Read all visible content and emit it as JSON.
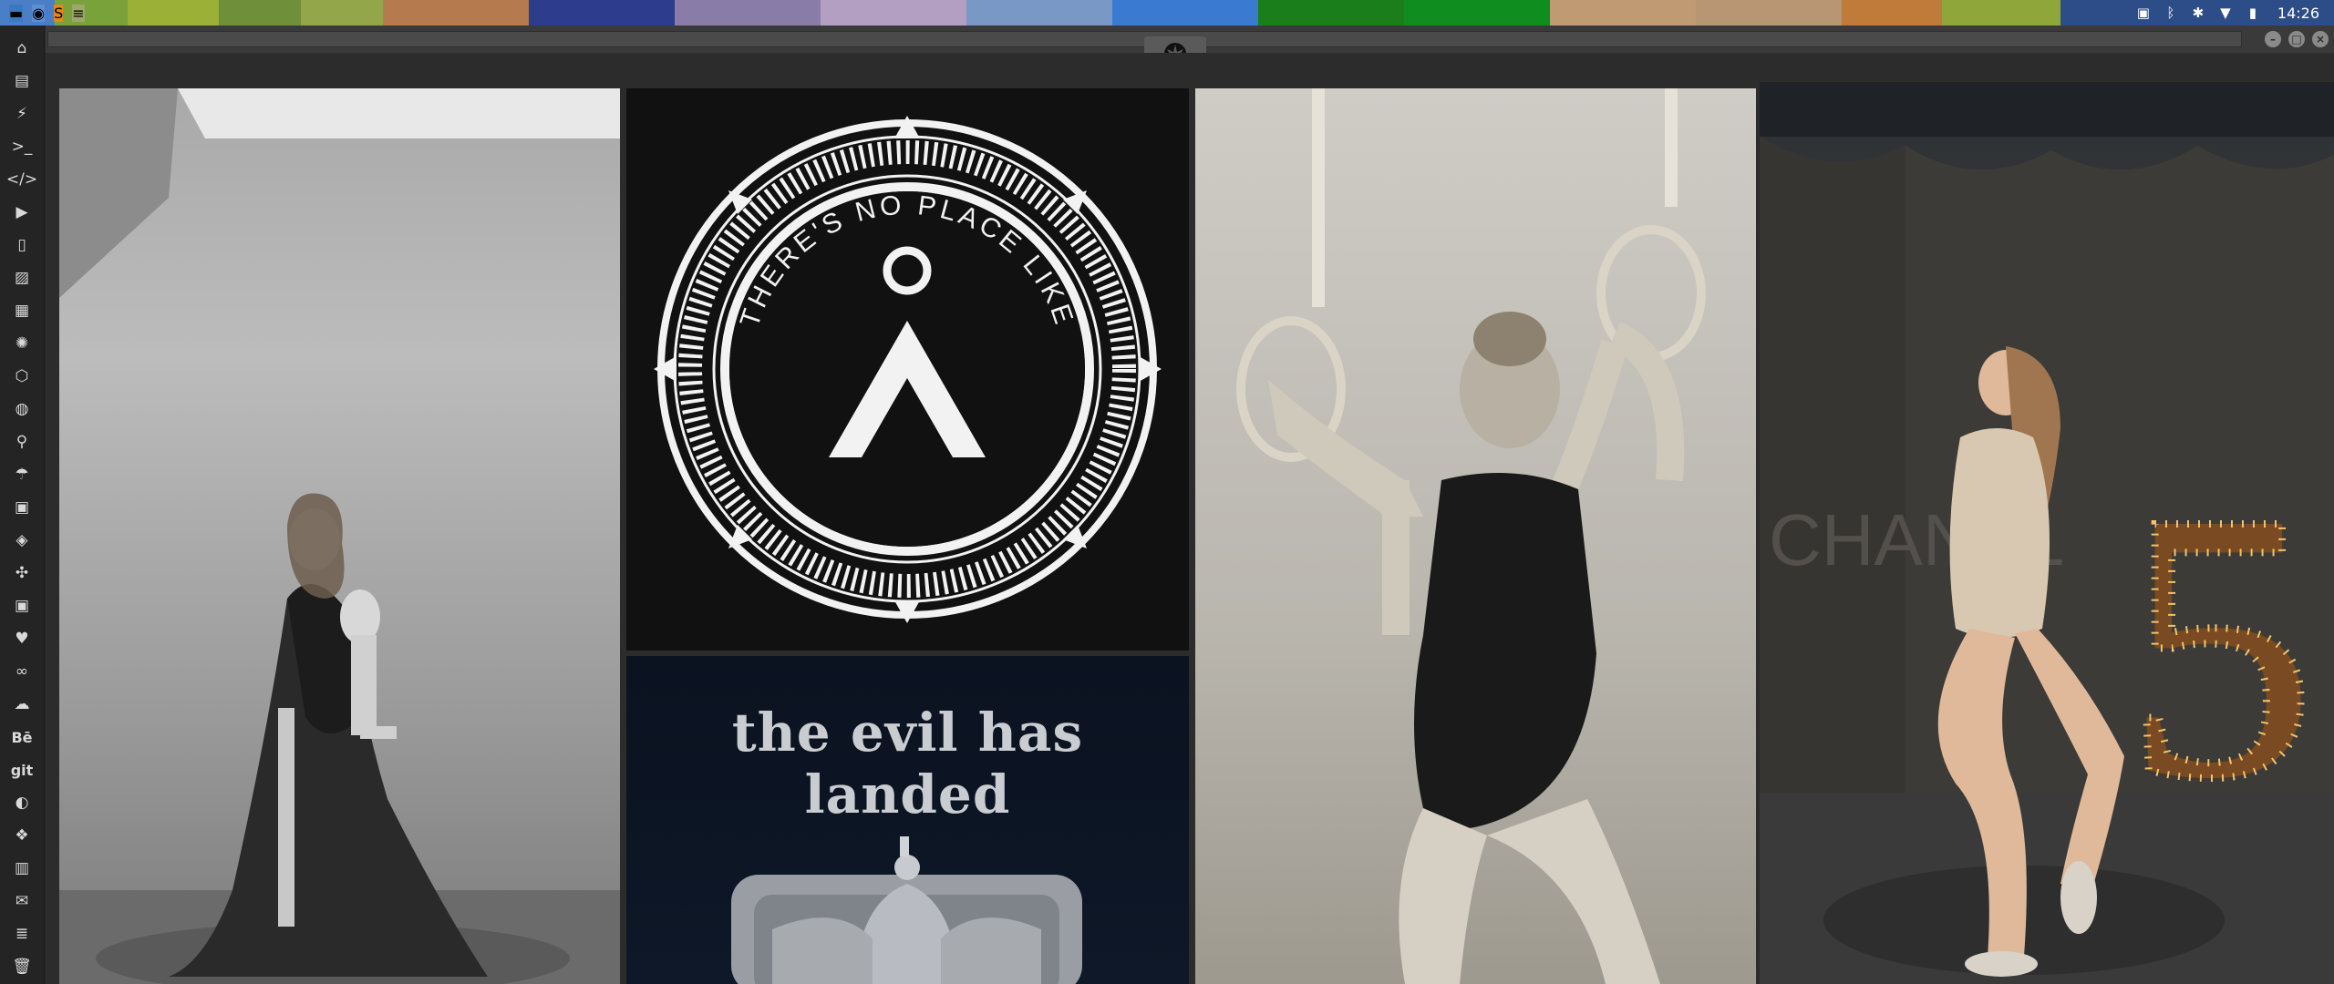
{
  "taskbar": {
    "segments": [
      {
        "color": "#4a7fc7",
        "w": 60
      },
      {
        "color": "#7aa23a",
        "w": 80
      },
      {
        "color": "#9bb036",
        "w": 100
      },
      {
        "color": "#6f8f3a",
        "w": 90
      },
      {
        "color": "#93a64a",
        "w": 90
      },
      {
        "color": "#b57a4e",
        "w": 160
      },
      {
        "color": "#2d3c8c",
        "w": 160
      },
      {
        "color": "#8a7ca8",
        "w": 160
      },
      {
        "color": "#b29fc2",
        "w": 160
      },
      {
        "color": "#7a98c5",
        "w": 160
      },
      {
        "color": "#3a7ad0",
        "w": 160
      },
      {
        "color": "#1a7f1a",
        "w": 160
      },
      {
        "color": "#0f8d1f",
        "w": 160
      },
      {
        "color": "#c09a72",
        "w": 160
      },
      {
        "color": "#b89673",
        "w": 160
      },
      {
        "color": "#c07a3a",
        "w": 110
      },
      {
        "color": "#8fa63a",
        "w": 130
      },
      {
        "color": "#2d4d88",
        "w": 210
      }
    ],
    "apps": [
      {
        "icon": "folder-icon",
        "glyph": "▬",
        "bg": "#3b78c4"
      },
      {
        "icon": "chrome-icon",
        "glyph": "◉",
        "bg": "#5a8fd0"
      },
      {
        "icon": "sublime-icon",
        "glyph": "S",
        "bg": "#e08a1a"
      },
      {
        "icon": "notes-icon",
        "glyph": "≡",
        "bg": "#9aa86a"
      }
    ],
    "tray": [
      {
        "icon": "screenshot-icon",
        "glyph": "▣"
      },
      {
        "icon": "bluetooth-icon",
        "glyph": "ᛒ"
      },
      {
        "icon": "alert-icon",
        "glyph": "✱"
      },
      {
        "icon": "wifi-icon",
        "glyph": "▼"
      },
      {
        "icon": "battery-icon",
        "glyph": "▮"
      }
    ],
    "clock": "14:26"
  },
  "sidebar": {
    "items": [
      {
        "name": "home-icon",
        "glyph": "⌂"
      },
      {
        "name": "document-icon",
        "glyph": "▤"
      },
      {
        "name": "bolt-icon",
        "glyph": "⚡"
      },
      {
        "name": "terminal-icon",
        "glyph": ">_"
      },
      {
        "name": "code-icon",
        "glyph": "</>"
      },
      {
        "name": "play-icon",
        "glyph": "▶"
      },
      {
        "name": "tablet-icon",
        "glyph": "▯"
      },
      {
        "name": "image-icon",
        "glyph": "▨"
      },
      {
        "name": "news-icon",
        "glyph": "▦"
      },
      {
        "name": "aperture-icon",
        "glyph": "✺"
      },
      {
        "name": "hexagon-icon",
        "glyph": "⬡"
      },
      {
        "name": "globe-icon",
        "glyph": "◍"
      },
      {
        "name": "search-icon",
        "glyph": "⚲"
      },
      {
        "name": "umbrella-icon",
        "glyph": "☂"
      },
      {
        "name": "contact-icon",
        "glyph": "▣"
      },
      {
        "name": "tag-icon",
        "glyph": "◈"
      },
      {
        "name": "expand-icon",
        "glyph": "✣"
      },
      {
        "name": "youtube-icon",
        "glyph": "▣"
      },
      {
        "name": "heart-icon",
        "glyph": "♥"
      },
      {
        "name": "link-icon",
        "glyph": "∞"
      },
      {
        "name": "cloud-icon",
        "glyph": "☁"
      },
      {
        "name": "behance-icon",
        "glyph": "Bē",
        "text": true
      },
      {
        "name": "git-icon",
        "glyph": "git",
        "text": true
      },
      {
        "name": "github-icon",
        "glyph": "◐"
      },
      {
        "name": "cubes-icon",
        "glyph": "❖"
      },
      {
        "name": "map-icon",
        "glyph": "▥"
      },
      {
        "name": "mail-icon",
        "glyph": "✉"
      },
      {
        "name": "server-icon",
        "glyph": "≣"
      },
      {
        "name": "trash-icon",
        "glyph": "🗑"
      }
    ]
  },
  "window": {
    "controls": [
      "–",
      "□",
      "×"
    ],
    "emblem": "rebel-alliance-icon"
  },
  "gallery": {
    "tile2": {
      "ring_text": "THERE'S NO PLACE LIKE"
    },
    "tile3": {
      "caption": "the evil has landed"
    },
    "tile5": {
      "backdrop_text": "CHANEL",
      "number": "5"
    }
  }
}
